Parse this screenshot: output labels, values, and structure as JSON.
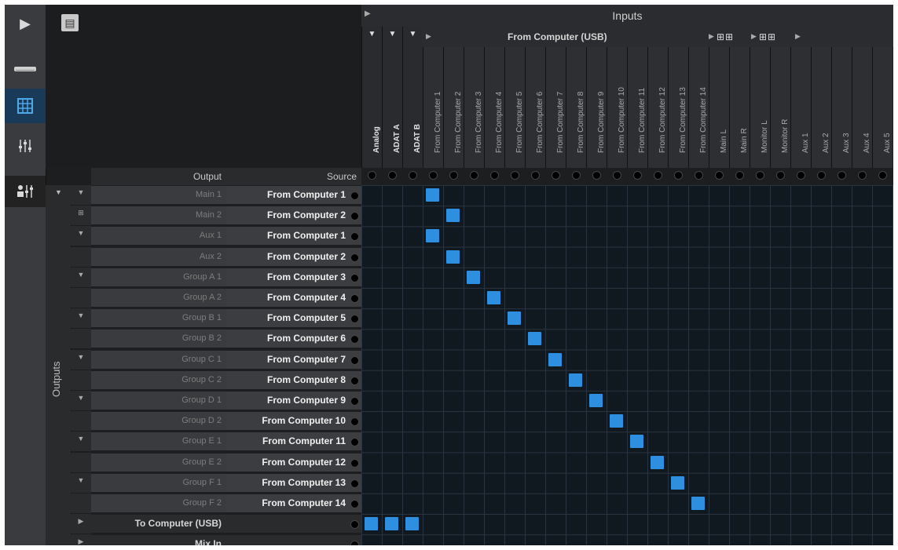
{
  "inputs_header": {
    "title": "Inputs"
  },
  "usb_header": {
    "title": "From Computer (USB)"
  },
  "input_groups": [
    "Analog",
    "ADAT A",
    "ADAT B"
  ],
  "input_columns": [
    "From Computer 1",
    "From Computer 2",
    "From Computer 3",
    "From Computer 4",
    "From Computer 5",
    "From Computer 6",
    "From Computer 7",
    "From Computer 8",
    "From Computer 9",
    "From Computer 10",
    "From Computer 11",
    "From Computer 12",
    "From Computer 13",
    "From Computer 14",
    "Main L",
    "Main R",
    "Monitor L",
    "Monitor R",
    "Aux 1",
    "Aux 2",
    "Aux 3",
    "Aux 4",
    "Aux 5"
  ],
  "table_headers": {
    "output": "Output",
    "source": "Source"
  },
  "outputs_label": "Outputs",
  "rows": [
    {
      "output": "Main 1",
      "source": "From Computer 1"
    },
    {
      "output": "Main 2",
      "source": "From Computer 2"
    },
    {
      "output": "Aux 1",
      "source": "From Computer 1"
    },
    {
      "output": "Aux 2",
      "source": "From Computer 2"
    },
    {
      "output": "Group A 1",
      "source": "From Computer 3"
    },
    {
      "output": "Group A 2",
      "source": "From Computer 4"
    },
    {
      "output": "Group B 1",
      "source": "From Computer 5"
    },
    {
      "output": "Group B 2",
      "source": "From Computer 6"
    },
    {
      "output": "Group C 1",
      "source": "From Computer 7"
    },
    {
      "output": "Group C 2",
      "source": "From Computer 8"
    },
    {
      "output": "Group D 1",
      "source": "From Computer 9"
    },
    {
      "output": "Group D 2",
      "source": "From Computer 10"
    },
    {
      "output": "Group E 1",
      "source": "From Computer 11"
    },
    {
      "output": "Group E 2",
      "source": "From Computer 12"
    },
    {
      "output": "Group F 1",
      "source": "From Computer 13"
    },
    {
      "output": "Group F 2",
      "source": "From Computer 14"
    }
  ],
  "sections": [
    {
      "label": "To Computer (USB)"
    },
    {
      "label": "Mix In"
    }
  ],
  "routing": [
    {
      "row": 0,
      "col": 3
    },
    {
      "row": 1,
      "col": 4
    },
    {
      "row": 2,
      "col": 3
    },
    {
      "row": 3,
      "col": 4
    },
    {
      "row": 4,
      "col": 5
    },
    {
      "row": 5,
      "col": 6
    },
    {
      "row": 6,
      "col": 7
    },
    {
      "row": 7,
      "col": 8
    },
    {
      "row": 8,
      "col": 9
    },
    {
      "row": 9,
      "col": 10
    },
    {
      "row": 10,
      "col": 11
    },
    {
      "row": 11,
      "col": 12
    },
    {
      "row": 12,
      "col": 13
    },
    {
      "row": 13,
      "col": 14
    },
    {
      "row": 14,
      "col": 15
    },
    {
      "row": 15,
      "col": 16
    },
    {
      "row": 16,
      "col": 0
    },
    {
      "row": 16,
      "col": 1
    },
    {
      "row": 16,
      "col": 2
    }
  ],
  "colors": {
    "active_cell": "#2e8fe0",
    "active_sidebar": "#4fa8e8"
  }
}
